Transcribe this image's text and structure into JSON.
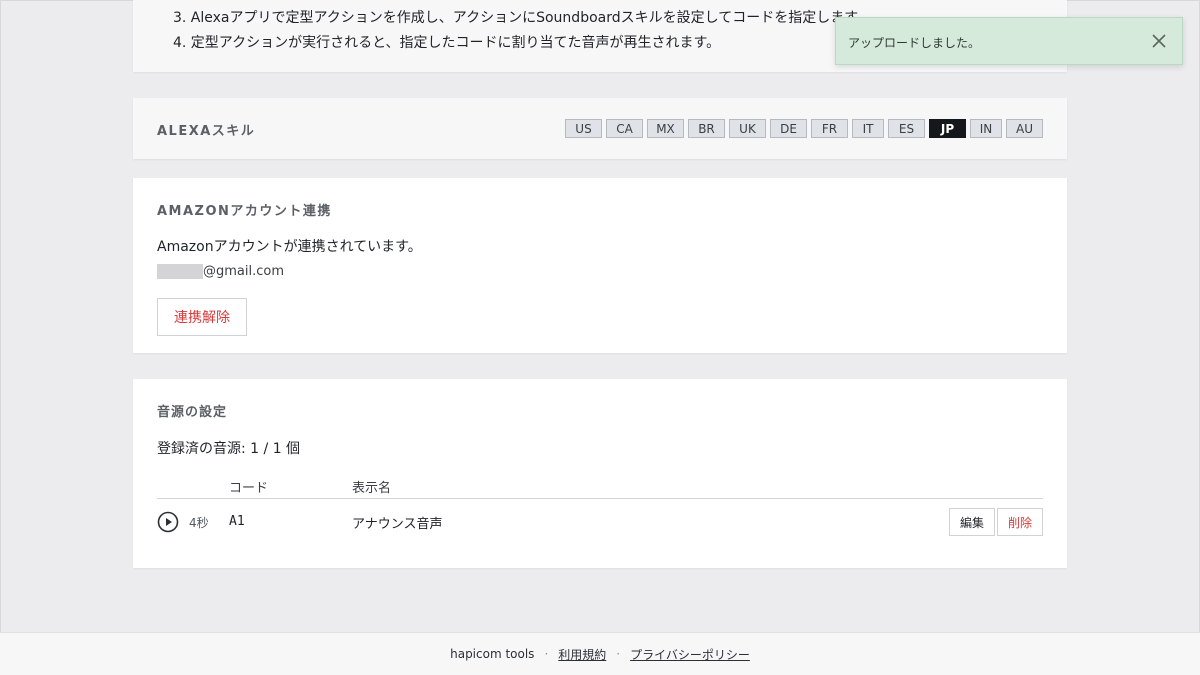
{
  "steps": {
    "items": [
      "3. Alexaアプリで定型アクションを作成し、アクションにSoundboardスキルを設定してコードを指定します。",
      "4. 定型アクションが実行されると、指定したコードに割り当てた音声が再生されます。"
    ]
  },
  "skill": {
    "title": "ALEXAスキル",
    "regions": [
      "US",
      "CA",
      "MX",
      "BR",
      "UK",
      "DE",
      "FR",
      "IT",
      "ES",
      "JP",
      "IN",
      "AU"
    ],
    "selected": "JP"
  },
  "account": {
    "title": "AMAZONアカウント連携",
    "message": "Amazonアカウントが連携されています。",
    "email_domain": "@gmail.com",
    "unlink_label": "連携解除"
  },
  "sounds": {
    "title": "音源の設定",
    "count_text": "登録済の音源: 1 / 1 個",
    "columns": {
      "code": "コード",
      "name": "表示名"
    },
    "rows": [
      {
        "duration": "4秒",
        "code": "A1",
        "name": "アナウンス音声",
        "edit_label": "編集",
        "delete_label": "削除"
      }
    ]
  },
  "toast": {
    "message": "アップロードしました。"
  },
  "footer": {
    "brand": "hapicom tools",
    "separator": "·",
    "terms": "利用規約",
    "privacy": "プライバシーポリシー"
  },
  "icons": {
    "play": "play-circle-icon",
    "close": "close-icon"
  },
  "colors": {
    "accent_dark": "#14171c",
    "danger": "#d63b3b",
    "toast_bg": "#d6eadc"
  }
}
